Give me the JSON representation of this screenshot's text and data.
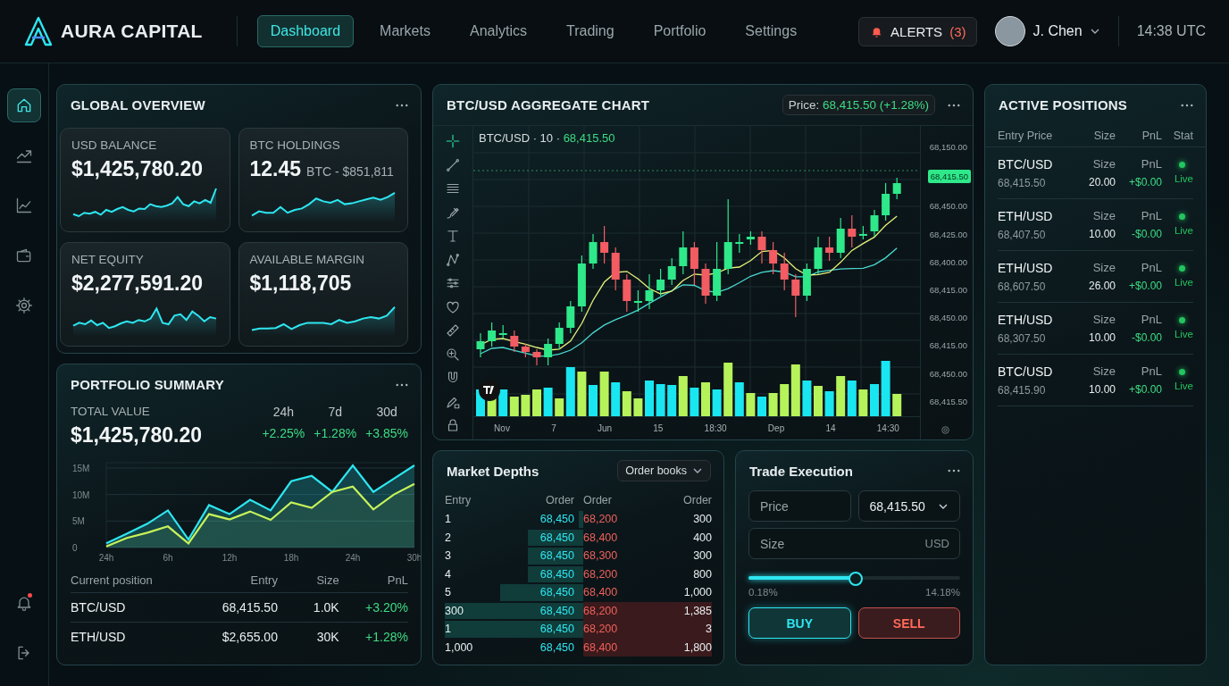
{
  "header": {
    "brand": "AURA CAPITAL",
    "nav": [
      {
        "label": "Dashboard",
        "selected": true
      },
      {
        "label": "Markets",
        "selected": false
      },
      {
        "label": "Analytics",
        "selected": false
      },
      {
        "label": "Trading",
        "selected": false
      },
      {
        "label": "Portfolio",
        "selected": false
      },
      {
        "label": "Settings",
        "selected": false
      }
    ],
    "alerts": {
      "label": "ALERTS",
      "count": "(3)"
    },
    "user": {
      "name": "J. Chen"
    },
    "time": "14:38 UTC"
  },
  "sidebar": {
    "items": [
      {
        "kind": "home",
        "selected": true
      },
      {
        "kind": "trend",
        "selected": false
      },
      {
        "kind": "chart",
        "selected": false
      },
      {
        "kind": "wallet",
        "selected": false
      },
      {
        "kind": "settings",
        "selected": false
      }
    ],
    "bottom": [
      {
        "kind": "bell",
        "notification": true
      },
      {
        "kind": "logout",
        "notification": false
      }
    ]
  },
  "global_overview": {
    "title": "GLOBAL OVERVIEW",
    "cards": [
      {
        "label": "USD BALANCE",
        "value": "$1,425,780.20"
      },
      {
        "label": "BTC HOLDINGS",
        "value": "12.45",
        "detail": "BTC - $851,811"
      },
      {
        "label": "NET EQUITY",
        "value": "$2,277,591.20"
      },
      {
        "label": "AVAILABLE MARGIN",
        "value": "$1,118,705"
      }
    ]
  },
  "portfolio_summary": {
    "title": "PORTFOLIO SUMMARY",
    "total_label": "TOTAL VALUE",
    "total_value": "$1,425,780.20",
    "periods": [
      {
        "label": "24h",
        "change": "+2.25%"
      },
      {
        "label": "7d",
        "change": "+1.28%"
      },
      {
        "label": "30d",
        "change": "+3.85%"
      }
    ],
    "chart_data": {
      "type": "area",
      "categories": [
        "24h",
        null,
        null,
        "6h",
        null,
        null,
        "12h",
        null,
        null,
        "18h",
        null,
        null,
        "24h",
        null,
        null,
        "30h"
      ],
      "ylim": [
        0,
        16
      ],
      "grid": true,
      "yticks": [
        {
          "value": 0,
          "label": "0"
        },
        {
          "value": 5,
          "label": "5M"
        },
        {
          "value": 10,
          "label": "10M"
        },
        {
          "value": 15,
          "label": "15M"
        }
      ],
      "series": [
        {
          "color": "#2ee6f0",
          "values": [
            0.8,
            2.6,
            4.5,
            7,
            1.5,
            8,
            6.3,
            9,
            7,
            12.5,
            13.5,
            10.5,
            15.5,
            10.5,
            13,
            15.5
          ]
        },
        {
          "color": "#c6f25a",
          "values": [
            0.2,
            1.8,
            2.8,
            4,
            0.8,
            6.3,
            5.3,
            6.8,
            5.2,
            8.5,
            7.5,
            10.5,
            11.5,
            7.2,
            10,
            12
          ]
        }
      ]
    },
    "table": {
      "columns": [
        "Current position",
        "Entry",
        "Size",
        "PnL"
      ],
      "rows": [
        {
          "pair": "BTC/USD",
          "entry": "68,415.50",
          "size": "1.0K",
          "pnl": "+3.20%"
        },
        {
          "pair": "ETH/USD",
          "entry": "$2,655.00",
          "size": "30K",
          "pnl": "+1.28%"
        }
      ]
    }
  },
  "aggregate_chart": {
    "title": "BTC/USD AGGREGATE CHART",
    "price_label": "Price:",
    "price_value": "68,415.50 (+1.28%)",
    "legend": "BTC/USD · 10 ·",
    "legend_price": "68,415.50",
    "current_price": "68,415.50",
    "price_axis": [
      "68,150.00",
      "68,450.00",
      "68,425.00",
      "68,400.00",
      "68,415.00",
      "68,450.00",
      "68,415.00",
      "68,450.00",
      "68,415.50"
    ],
    "time_axis": [
      "Nov",
      "7",
      "Jun",
      "15",
      "18:30",
      "Dep",
      "14",
      "14:30"
    ]
  },
  "market_depth": {
    "title": "Market Depths",
    "dropdown": "Order books",
    "columns": [
      "Entry",
      "Order",
      "Order",
      "Order"
    ],
    "rows": [
      {
        "entry": "1",
        "bid": "68,450",
        "ask": "68,200",
        "order": "300",
        "highlighted": false
      },
      {
        "entry": "2",
        "bid": "68,450",
        "ask": "68,400",
        "order": "400",
        "highlighted": false
      },
      {
        "entry": "3",
        "bid": "68,450",
        "ask": "68,300",
        "order": "300",
        "highlighted": false
      },
      {
        "entry": "4",
        "bid": "68,450",
        "ask": "68,200",
        "order": "800",
        "highlighted": false
      },
      {
        "entry": "5",
        "bid": "68,450",
        "ask": "68,400",
        "order": "1,000",
        "highlighted": false
      },
      {
        "entry": "300",
        "bid": "68,450",
        "ask": "68,200",
        "order": "1,385",
        "highlighted": true
      },
      {
        "entry": "1",
        "bid": "68,450",
        "ask": "68,200",
        "order": "3",
        "highlighted": true
      },
      {
        "entry": "1,000",
        "bid": "68,450",
        "ask": "68,400",
        "order": "1,800",
        "highlighted": true
      }
    ]
  },
  "trade_execution": {
    "title": "Trade Execution",
    "price_placeholder": "Price",
    "price_select": "68,415.50",
    "size_placeholder": "Size",
    "size_unit": "USD",
    "slider": {
      "level": 0.5,
      "min_label": "0.18%",
      "max_label": "14.18%"
    },
    "buttons": [
      {
        "kind": "buy",
        "label": "BUY"
      },
      {
        "kind": "sell",
        "label": "SELL"
      }
    ]
  },
  "active_positions": {
    "title": "ACTIVE POSITIONS",
    "columns": [
      "Entry Price",
      "Size",
      "PnL",
      "Stat"
    ],
    "rows": [
      {
        "pair": "BTC/USD",
        "entry": "68,415.50",
        "size_label": "Size",
        "size": "20.00",
        "pnl_label": "PnL",
        "pnl": "+$0.00",
        "status": "Live",
        "color": "#22c55e"
      },
      {
        "pair": "ETH/USD",
        "entry": "68,407.50",
        "size_label": "Size",
        "size": "10.00",
        "pnl_label": "PnL",
        "pnl": "-$0.00",
        "status": "Live",
        "color": "#22c55e"
      },
      {
        "pair": "ETH/USD",
        "entry": "68,607.50",
        "size_label": "Size",
        "size": "26.00",
        "pnl_label": "PnL",
        "pnl": "+$0.00",
        "status": "Live",
        "color": "#22c55e"
      },
      {
        "pair": "ETH/USD",
        "entry": "68,307.50",
        "size_label": "Size",
        "size": "10.00",
        "pnl_label": "PnL",
        "pnl": "-$0.00",
        "status": "Live",
        "color": "#22c55e"
      },
      {
        "pair": "BTC/USD",
        "entry": "68,415.90",
        "size_label": "Size",
        "size": "10.00",
        "pnl_label": "PnL",
        "pnl": "+$0.00",
        "status": "Live",
        "color": "#22c55e"
      }
    ]
  }
}
